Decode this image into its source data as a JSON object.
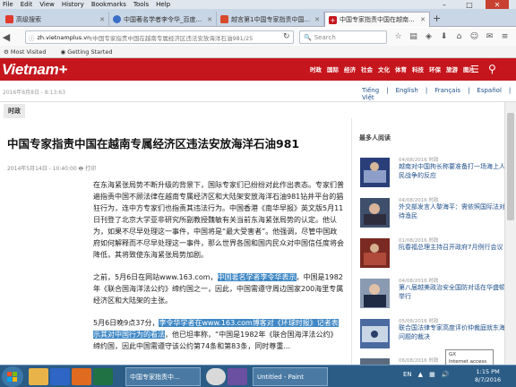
{
  "menu": [
    "File",
    "Edit",
    "View",
    "History",
    "Bookmarks",
    "Tools",
    "Help"
  ],
  "tabs": [
    {
      "label": "高级搜索",
      "color": "#e13a2d",
      "active": false
    },
    {
      "label": "中国著名学者李令华_百度...",
      "color": "#3b6ec6",
      "active": false
    },
    {
      "label": "越言第1中国专家指责中国...",
      "color": "#d94a2c",
      "active": false
    },
    {
      "label": "中国专家指责中国在越南...",
      "color": "#c5161d",
      "active": true
    }
  ],
  "nav": {
    "url_domain": "zh.vietnamplus.vn",
    "url_path": "/中国专家指责中国在越南专属经济区违法安放海洋石油981/25",
    "search_placeholder": "Search"
  },
  "bookmarks": [
    "Most Visited",
    "Getting Started"
  ],
  "site": {
    "logo": "Vietnam+",
    "nav": [
      "时政",
      "国际",
      "经济",
      "社会",
      "文化",
      "体育",
      "科技",
      "环保",
      "旅游",
      "图片"
    ],
    "date": "2016年8月8日 - 8:13:63",
    "languages": [
      "Tiếng Việt",
      "English",
      "Français",
      "Español",
      "中文"
    ],
    "category": "时政"
  },
  "article": {
    "title": "中国专家指责中国在越南专属经济区违法安放海洋石油981",
    "meta": "2014年5月14日 - 10:40:00  🖶 打印",
    "p1": "在东海紧张局势不断升级的背景下，国际专家们已纷纷对此作出表态。专家们普遍指责中国不顾法律在越南专属经济区和大陆架安放海洋石油981钻井平台的猖狂行为，连中方专家们也指责其违法行为。中国香港《南华早报》英文版5月11日刊登了北京大学亚非研究所副教授魏敏有关当前东海紧张局势的认定。他认为，如果不尽早处理这一事件，中国将是“最大受害者”。他强调，尽管中国政府如何解释而不尽早处理这一事件，那么世界各国和国内民众对中国信任度将会降低，其将致使东海紧张局势加剧。",
    "p2_a": "之前，5月6日在网站www.163.com，",
    "p2_hl": "中国著名学者李令华表示",
    "p2_b": "，中国是1982年《联合国海洋法公约》缔约国之一，因此，中国需遵守周边国家200海里专属经济区和大陆架的主张。",
    "p3_a": "5月6日晚9点37分，",
    "p3_hl": "李令华学者在www.163.com博客对《环球时报》记者表示其对中国行为的看法",
    "p3_b": "，他已坦率称，“中国是1982年《联合国海洋法公约》缔约国，因此中国需遵守该公约第74条和第83条，同时尊重..."
  },
  "sidebar": {
    "title": "最多人阅读",
    "items": [
      {
        "meta": "04/08/2016 时政",
        "text": "越南对中国拘长称要准备打一场海上人民战争的反应"
      },
      {
        "meta": "04/08/2016 时政",
        "text": "外交部发言人黎海平：需依照国际法对待渔民"
      },
      {
        "meta": "01/08/2016 时政",
        "text": "阮春福总理主持召开政府7月例行会议"
      },
      {
        "meta": "04/08/2016 时政",
        "text": "第八届越美政治安全国防对话在华盛顿举行"
      },
      {
        "meta": "05/08/2016 时政",
        "text": "联合国法律专家高度评价仲裁庭就东海问题的裁决"
      },
      {
        "meta": "06/08/2016 时政",
        "text": ""
      }
    ]
  },
  "tooltip": {
    "line1": "GX",
    "line2": "Internet access"
  },
  "taskbar": {
    "tasks": [
      "中国专家指责中...",
      "Untitled - Paint"
    ],
    "lang": "EN",
    "time": "1:15 PM",
    "date": "8/7/2016"
  }
}
